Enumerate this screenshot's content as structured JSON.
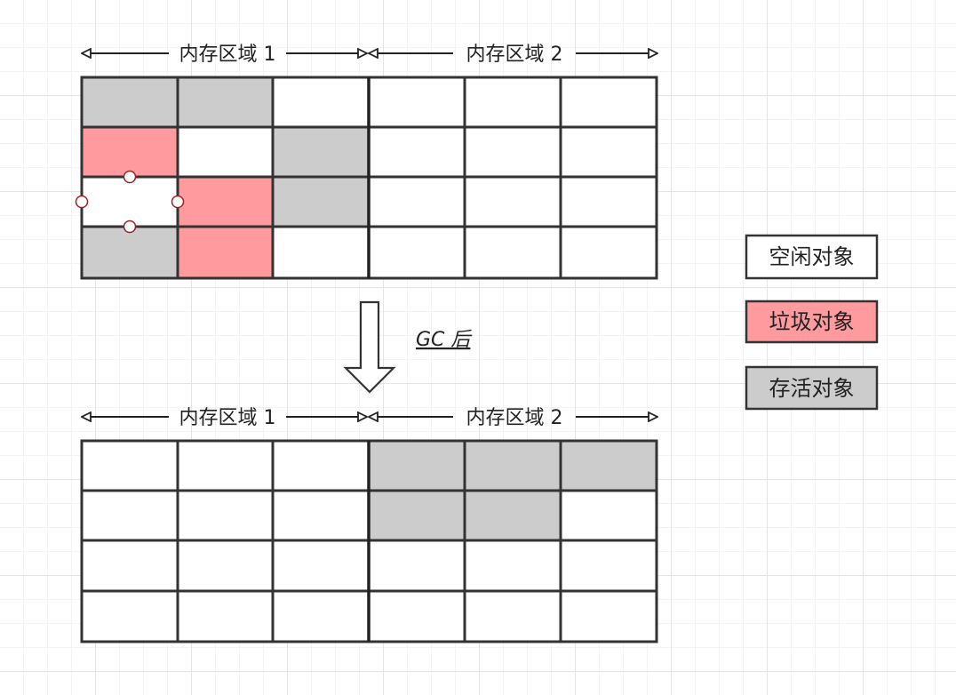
{
  "colors": {
    "free": "#ffffff",
    "garbage": "#ff9a9e",
    "alive": "#cccccc",
    "line": "#333333"
  },
  "before": {
    "region_labels": [
      "内存区域 1",
      "内存区域 2"
    ],
    "grid": [
      [
        "alive",
        "alive",
        "free",
        "free",
        "free",
        "free"
      ],
      [
        "garbage",
        "free",
        "alive",
        "free",
        "free",
        "free"
      ],
      [
        "free",
        "garbage",
        "alive",
        "free",
        "free",
        "free"
      ],
      [
        "alive",
        "garbage",
        "free",
        "free",
        "free",
        "free"
      ]
    ]
  },
  "transition": {
    "label": "GC 后"
  },
  "after": {
    "region_labels": [
      "内存区域 1",
      "内存区域 2"
    ],
    "grid": [
      [
        "free",
        "free",
        "free",
        "alive",
        "alive",
        "alive"
      ],
      [
        "free",
        "free",
        "free",
        "alive",
        "alive",
        "free"
      ],
      [
        "free",
        "free",
        "free",
        "free",
        "free",
        "free"
      ],
      [
        "free",
        "free",
        "free",
        "free",
        "free",
        "free"
      ]
    ]
  },
  "legend": [
    {
      "key": "free",
      "label": "空闲对象"
    },
    {
      "key": "garbage",
      "label": "垃圾对象"
    },
    {
      "key": "alive",
      "label": "存活对象"
    }
  ]
}
